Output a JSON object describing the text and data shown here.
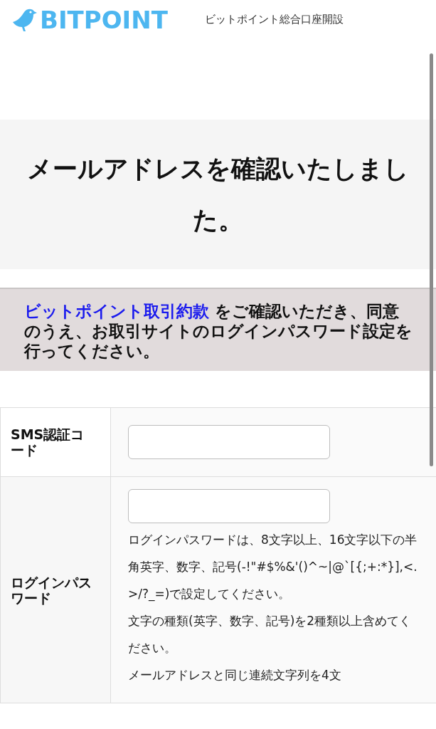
{
  "header": {
    "logo": "BITPOINT",
    "title": "ビットポイント総合口座開設"
  },
  "page_title": "メールアドレスを確認いたしました。",
  "notice": {
    "link": "ビットポイント取引約款",
    "text": " をご確認いただき、同意のうえ、お取引サイトのログインパスワード設定を行ってください。"
  },
  "form": {
    "rows": [
      {
        "label": "SMS認証コード",
        "help": []
      },
      {
        "label": "ログインパスワード",
        "help": [
          "ログインパスワードは、8文字以上、16文字以下の半角英字、数字、記号(-!\"#$%&'()^~|@`[{;+:*}],<.>/?_=)で設定してください。",
          "文字の種類(英字、数字、記号)を2種類以上含めてください。",
          "メールアドレスと同じ連続文字列を4文"
        ]
      }
    ]
  }
}
